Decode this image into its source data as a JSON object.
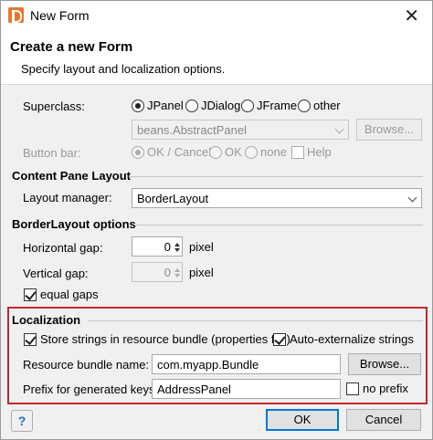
{
  "window": {
    "title": "New Form",
    "close_symbol": "✕"
  },
  "header": {
    "title": "Create a new Form",
    "subtitle": "Specify layout and localization options."
  },
  "superclass": {
    "label": "Superclass:",
    "options": [
      "JPanel",
      "JDialog",
      "JFrame",
      "other"
    ],
    "selected": "JPanel",
    "class_value": "beans.AbstractPanel",
    "browse_label": "Browse..."
  },
  "button_bar": {
    "label": "Button bar:",
    "options": [
      "OK / Cancel",
      "OK",
      "none"
    ],
    "selected": "OK / Cancel",
    "help_label": "Help"
  },
  "content_pane": {
    "section_title": "Content Pane Layout",
    "layout_label": "Layout manager:",
    "layout_value": "BorderLayout"
  },
  "border_layout": {
    "section_title": "BorderLayout options",
    "hgap_label": "Horizontal gap:",
    "hgap_value": "0",
    "hgap_unit": "pixel",
    "vgap_label": "Vertical gap:",
    "vgap_value": "0",
    "vgap_unit": "pixel",
    "equal_gaps_label": "equal gaps",
    "equal_gaps_checked": true
  },
  "localization": {
    "section_title": "Localization",
    "store_label": "Store strings in resource bundle (properties file)",
    "store_checked": true,
    "auto_label": "Auto-externalize strings",
    "auto_checked": true,
    "bundle_label": "Resource bundle name:",
    "bundle_value": "com.myapp.Bundle",
    "browse_label": "Browse...",
    "prefix_label": "Prefix for generated keys:",
    "prefix_value": "AddressPanel",
    "no_prefix_label": "no prefix",
    "no_prefix_checked": false
  },
  "footer": {
    "help_symbol": "?",
    "ok_label": "OK",
    "cancel_label": "Cancel"
  },
  "colors": {
    "highlight": "#c0282d",
    "default_button_border": "#0078d7",
    "app_icon": "#e8762c"
  }
}
